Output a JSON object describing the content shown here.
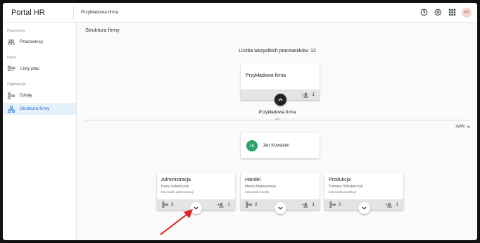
{
  "header": {
    "brand": "Portal HR",
    "breadcrumb": "Przykładowa firma",
    "user_initials": "KP"
  },
  "sidebar": {
    "sections": [
      {
        "label": "Pracownicy",
        "items": [
          {
            "label": "Pracownicy",
            "icon": "people-icon"
          }
        ]
      },
      {
        "label": "Płace",
        "items": [
          {
            "label": "Listy płac",
            "icon": "payroll-icon"
          }
        ]
      },
      {
        "label": "Organizacja",
        "items": [
          {
            "label": "Działy",
            "icon": "departments-icon"
          },
          {
            "label": "Struktura firmy",
            "icon": "org-structure-icon",
            "active": true
          }
        ]
      }
    ]
  },
  "main": {
    "title": "Struktura firmy",
    "total_label": "Liczba wszystkich pracowników: 12",
    "company_card": {
      "name": "Przykładowa firma",
      "people_count": "1"
    },
    "separator_label": "Przykładowa firma",
    "collapse_label": "ZWIŃ",
    "manager": {
      "initials": "JK",
      "name": "Jan Kowalski"
    },
    "departments": [
      {
        "name": "Administracja",
        "head": "Karol Adamczuk",
        "role": "Kierownik administracji",
        "subunits": "2",
        "people": "1"
      },
      {
        "name": "Handel",
        "head": "Maria Malinowska",
        "role": "Kierownik handlu",
        "subunits": "2",
        "people": "1"
      },
      {
        "name": "Produkcja",
        "head": "Tomasz Włodarczyk",
        "role": "Kierownik produkcji",
        "subunits": "2",
        "people": "1"
      }
    ]
  },
  "colors": {
    "accent": "#1e6fcf",
    "active_bg": "#e6f1fb",
    "manager_avatar": "#2aa36a",
    "arrow": "#e02020"
  }
}
